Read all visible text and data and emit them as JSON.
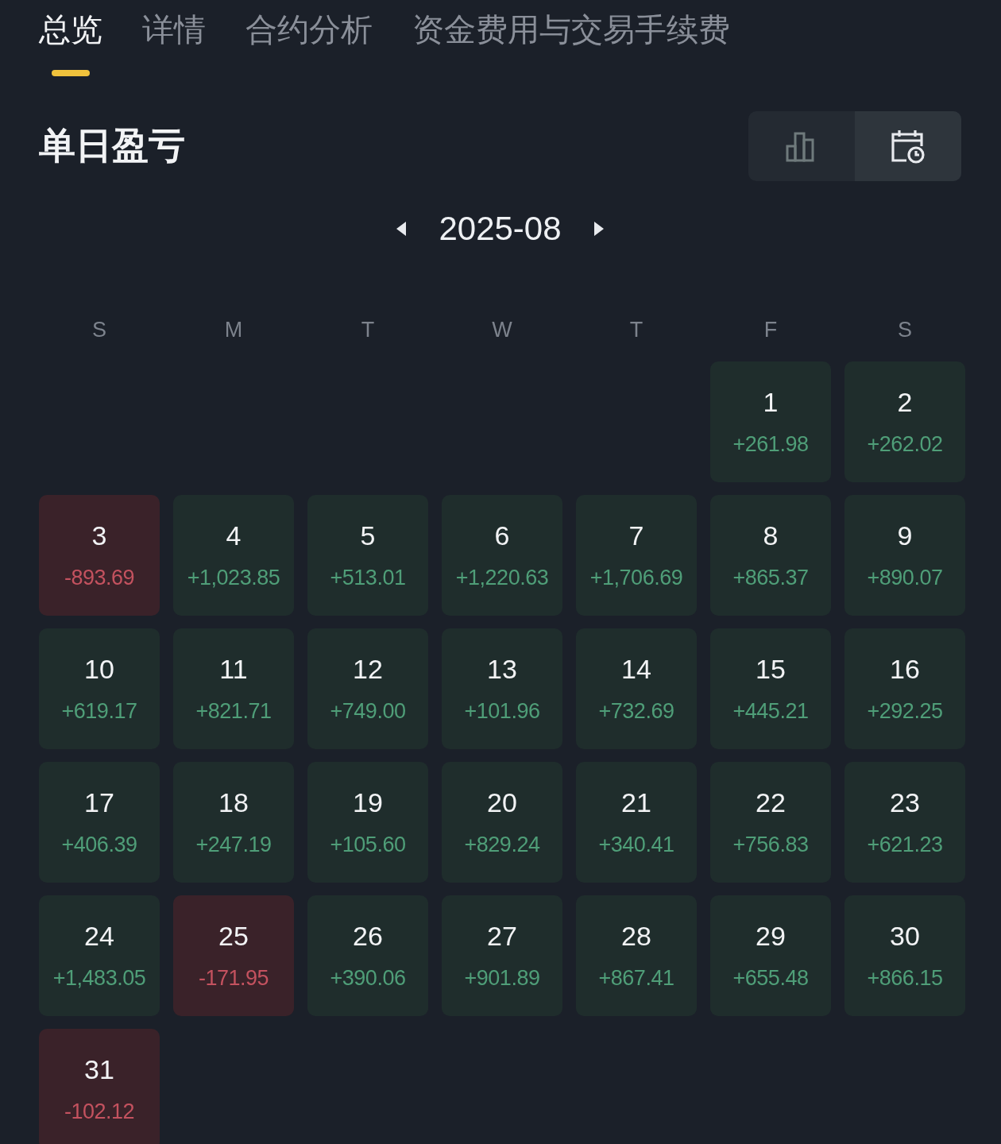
{
  "tabs": [
    {
      "label": "总览",
      "selected": true
    },
    {
      "label": "详情",
      "selected": false
    },
    {
      "label": "合约分析",
      "selected": false
    },
    {
      "label": "资金费用与交易手续费",
      "selected": false
    }
  ],
  "section": {
    "title": "单日盈亏",
    "views": [
      {
        "kind": "chart",
        "selected": false
      },
      {
        "kind": "calendar",
        "selected": true
      }
    ]
  },
  "month": "2025-08",
  "weekdays": [
    "S",
    "M",
    "T",
    "W",
    "T",
    "F",
    "S"
  ],
  "days": [
    {
      "kind": "blank"
    },
    {
      "kind": "blank"
    },
    {
      "kind": "blank"
    },
    {
      "kind": "blank"
    },
    {
      "kind": "blank"
    },
    {
      "kind": "gain",
      "day": "1",
      "pnl": "+261.98"
    },
    {
      "kind": "gain",
      "day": "2",
      "pnl": "+262.02"
    },
    {
      "kind": "loss",
      "day": "3",
      "pnl": "-893.69"
    },
    {
      "kind": "gain",
      "day": "4",
      "pnl": "+1,023.85"
    },
    {
      "kind": "gain",
      "day": "5",
      "pnl": "+513.01"
    },
    {
      "kind": "gain",
      "day": "6",
      "pnl": "+1,220.63"
    },
    {
      "kind": "gain",
      "day": "7",
      "pnl": "+1,706.69"
    },
    {
      "kind": "gain",
      "day": "8",
      "pnl": "+865.37"
    },
    {
      "kind": "gain",
      "day": "9",
      "pnl": "+890.07"
    },
    {
      "kind": "gain",
      "day": "10",
      "pnl": "+619.17"
    },
    {
      "kind": "gain",
      "day": "11",
      "pnl": "+821.71"
    },
    {
      "kind": "gain",
      "day": "12",
      "pnl": "+749.00"
    },
    {
      "kind": "gain",
      "day": "13",
      "pnl": "+101.96"
    },
    {
      "kind": "gain",
      "day": "14",
      "pnl": "+732.69"
    },
    {
      "kind": "gain",
      "day": "15",
      "pnl": "+445.21"
    },
    {
      "kind": "gain",
      "day": "16",
      "pnl": "+292.25"
    },
    {
      "kind": "gain",
      "day": "17",
      "pnl": "+406.39"
    },
    {
      "kind": "gain",
      "day": "18",
      "pnl": "+247.19"
    },
    {
      "kind": "gain",
      "day": "19",
      "pnl": "+105.60"
    },
    {
      "kind": "gain",
      "day": "20",
      "pnl": "+829.24"
    },
    {
      "kind": "gain",
      "day": "21",
      "pnl": "+340.41"
    },
    {
      "kind": "gain",
      "day": "22",
      "pnl": "+756.83"
    },
    {
      "kind": "gain",
      "day": "23",
      "pnl": "+621.23"
    },
    {
      "kind": "gain",
      "day": "24",
      "pnl": "+1,483.05"
    },
    {
      "kind": "loss",
      "day": "25",
      "pnl": "-171.95"
    },
    {
      "kind": "gain",
      "day": "26",
      "pnl": "+390.06"
    },
    {
      "kind": "gain",
      "day": "27",
      "pnl": "+901.89"
    },
    {
      "kind": "gain",
      "day": "28",
      "pnl": "+867.41"
    },
    {
      "kind": "gain",
      "day": "29",
      "pnl": "+655.48"
    },
    {
      "kind": "gain",
      "day": "30",
      "pnl": "+866.15"
    },
    {
      "kind": "loss",
      "day": "31",
      "pnl": "-102.12"
    }
  ]
}
